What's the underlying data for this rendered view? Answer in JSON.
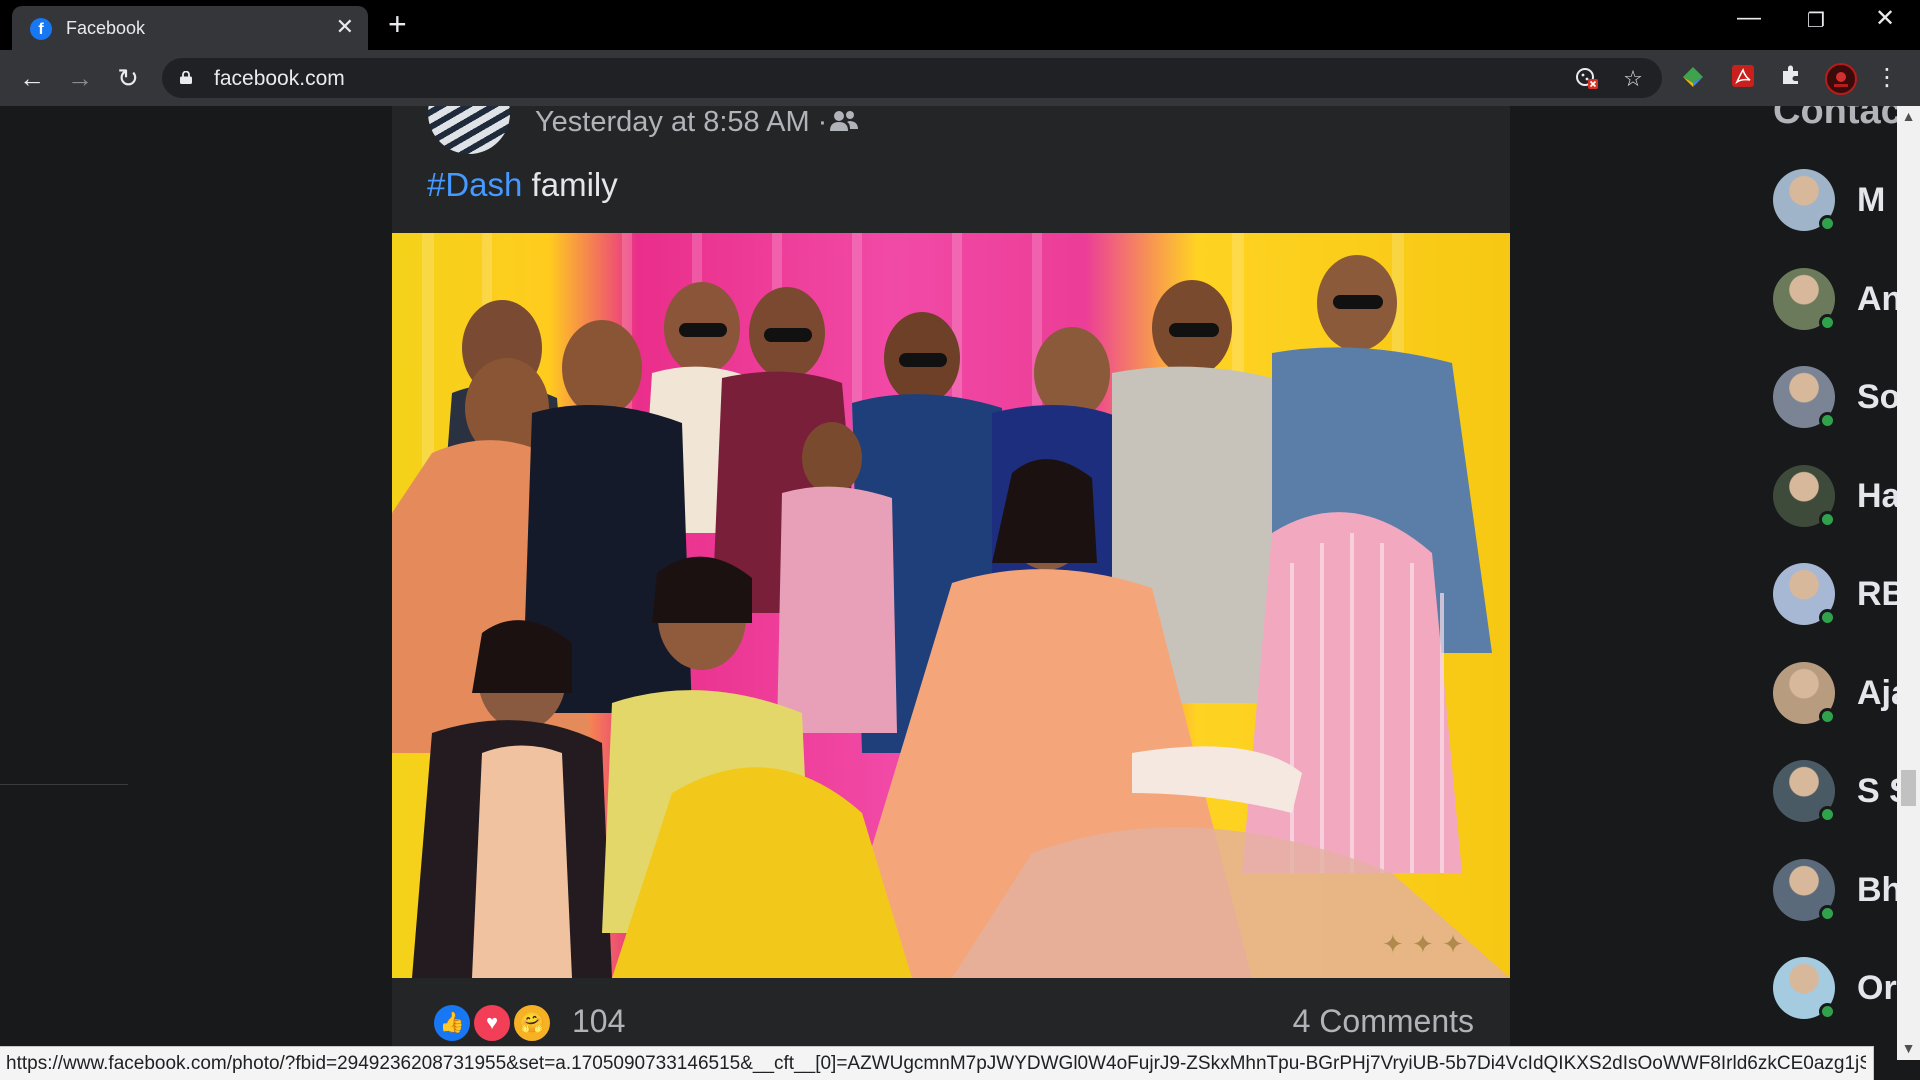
{
  "browser": {
    "tab_title": "Facebook",
    "favicon_letter": "f",
    "tab_close": "✕",
    "new_tab": "+",
    "url": "facebook.com",
    "window_controls": {
      "minimize": "—",
      "maximize": "❐",
      "close": "✕"
    },
    "nav": {
      "back": "←",
      "forward": "→",
      "reload": "↻"
    },
    "icons": [
      "lock-icon",
      "cookie-blocked-icon",
      "star-icon",
      "extension-icon",
      "pdf-icon",
      "puzzle-icon",
      "profile-icon",
      "menu-icon"
    ]
  },
  "post": {
    "timestamp": "Yesterday at 8:58 AM ·",
    "audience_icon": "friends-icon",
    "hashtag": "#Dash",
    "text": " family",
    "reactions": {
      "like": "👍",
      "love": "♥",
      "care": "🤗"
    },
    "reaction_count": "104",
    "comments": "4 Comments"
  },
  "contacts": {
    "heading": "Contac",
    "items": [
      {
        "name": "M",
        "color": "#9fb4c8"
      },
      {
        "name": "An",
        "color": "#6b7a5a"
      },
      {
        "name": "So",
        "color": "#7a8494"
      },
      {
        "name": "Ha",
        "color": "#3e4a3a"
      },
      {
        "name": "RB",
        "color": "#a7b8d4"
      },
      {
        "name": "Aja",
        "color": "#b89c80"
      },
      {
        "name": "S S",
        "color": "#4a5a64"
      },
      {
        "name": "Bh",
        "color": "#5a6a7a"
      },
      {
        "name": "Or",
        "color": "#a4cbe0"
      }
    ]
  },
  "status_bar": {
    "url": "https://www.facebook.com/photo/?fbid=2949236208731955&set=a.1705090733146515&__cft__[0]=AZWUgcmnM7pJWYDWGl0W4oFujrJ9-ZSkxMhnTpu-BGrPHj7VryiUB-5b7Di4VcIdQIKXS2dIsOoWWF8Irld6zkCE0azg1jSvw907YqvpYSB..."
  },
  "colors": {
    "accent": "#1877f2",
    "hashtag": "#4599ff",
    "online": "#31a24c"
  }
}
